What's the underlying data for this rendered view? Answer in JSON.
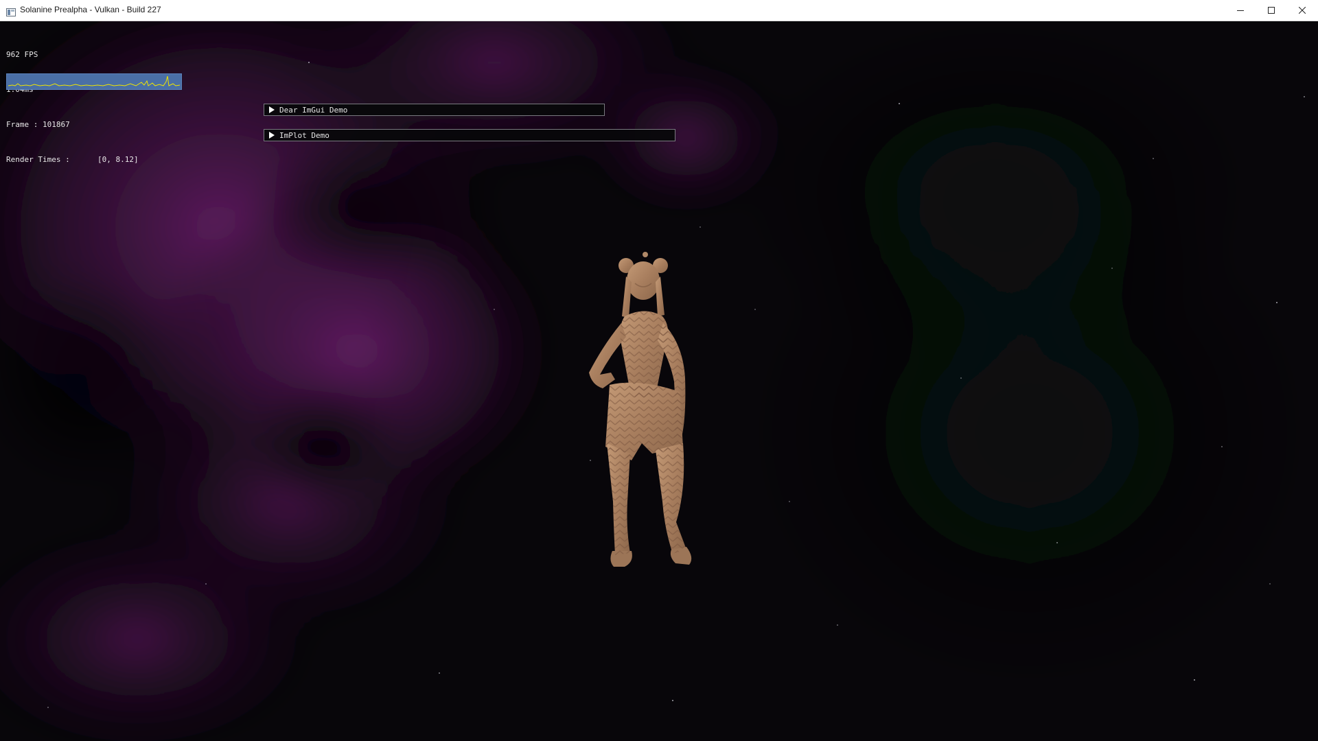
{
  "window": {
    "title": "Solanine Prealpha - Vulkan - Build 227",
    "controls": [
      "minimize",
      "maximize",
      "close"
    ]
  },
  "overlay": {
    "fps": "962 FPS",
    "frame_time": "1.04ms",
    "frame_counter": "Frame : 101867",
    "render_times_label": "Render Times :",
    "render_times_range": "[0, 8.12]",
    "render_times_plot": {
      "range": [
        0,
        8.12
      ],
      "line_color": "#f2e600",
      "background_color": "#4a6fa6"
    }
  },
  "imgui_windows": [
    {
      "title": "Dear ImGui Demo",
      "collapsed": true
    },
    {
      "title": "ImPlot Demo",
      "collapsed": true
    }
  ],
  "scene": {
    "background": "nebula space skybox",
    "nebula_color": "#5a1a5c",
    "character_color": "#b08868"
  }
}
